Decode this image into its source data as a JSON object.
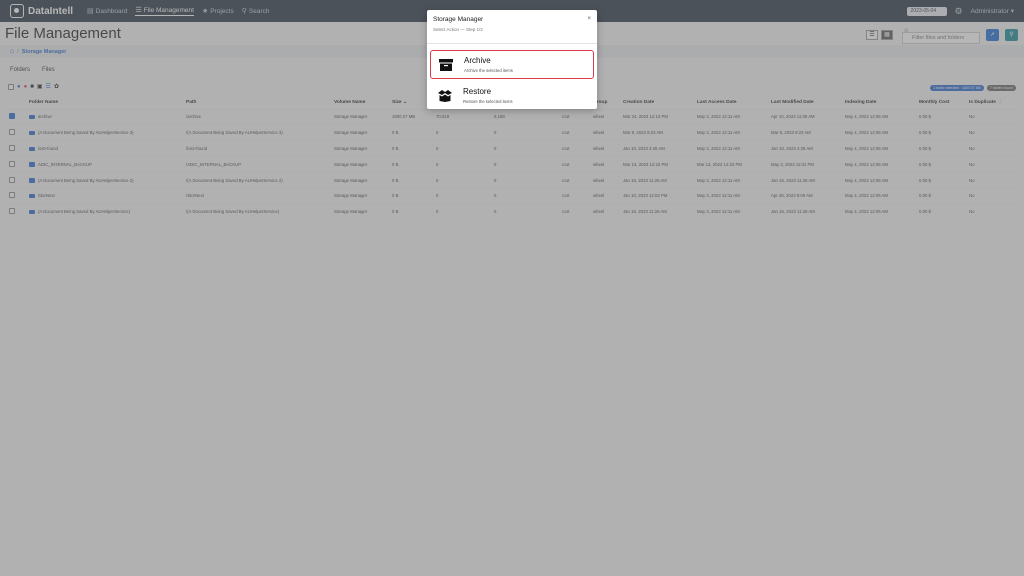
{
  "nav": {
    "brand": "DataIntell",
    "items": [
      {
        "label": "Dashboard",
        "icon": "chart-icon"
      },
      {
        "label": "File Management",
        "icon": "list-icon"
      },
      {
        "label": "Projects",
        "icon": "sitemap-icon"
      },
      {
        "label": "Search",
        "icon": "search-icon"
      }
    ],
    "date": "2023-05-04",
    "user": "Administrator"
  },
  "page": {
    "title": "File Management",
    "filter_placeholder": "Filter files and folders",
    "breadcrumb": "Storage Manager"
  },
  "tabs": [
    "Folders",
    "Files"
  ],
  "summary": {
    "selected": "1 folder selected · 1800.07 MB",
    "found": "7 folders found"
  },
  "table": {
    "columns": [
      "Folder Name",
      "Path",
      "Volume Name",
      "Size",
      "",
      "",
      "",
      "Group",
      "Creation Date",
      "Last Access Date",
      "Last Modified Date",
      "Indexing Date",
      "Monthly Cost",
      "Is Duplicate"
    ],
    "rows": [
      {
        "checked": true,
        "name": "archive",
        "path": "/archive",
        "volume": "Storage Manager",
        "size": "1800.07 MB",
        "c1": "70,519",
        "c2": "9,188",
        "owner": "root",
        "group": "wheel",
        "created": "Mar 24, 2023 12:13 PM",
        "accessed": "May 3, 2023 12:11 AM",
        "modified": "Apr 10, 2023 11:08 AM",
        "indexed": "May 4, 2023 12:06 AM",
        "cost": "0.00 $",
        "dup": "No"
      },
      {
        "checked": false,
        "name": "(A Document Being Saved By AUHelperService 3)",
        "path": "/(A Document Being Saved By AUHelperService 3)",
        "volume": "Storage Manager",
        "size": "0 B",
        "c1": "0",
        "c2": "0",
        "owner": "root",
        "group": "wheel",
        "created": "Mar 8, 2023 8:23 AM",
        "accessed": "May 3, 2023 12:11 AM",
        "modified": "Mar 8, 2023 8:23 AM",
        "indexed": "May 4, 2023 12:06 AM",
        "cost": "0.00 $",
        "dup": "No"
      },
      {
        "checked": false,
        "name": "lost+found",
        "path": "/lost+found",
        "volume": "Storage Manager",
        "size": "0 B",
        "c1": "0",
        "c2": "0",
        "owner": "root",
        "group": "wheel",
        "created": "Jan 10, 2023 4:28 AM",
        "accessed": "May 3, 2023 12:11 AM",
        "modified": "Jan 10, 2023 4:28 AM",
        "indexed": "May 4, 2023 12:06 AM",
        "cost": "0.00 $",
        "dup": "No"
      },
      {
        "checked": false,
        "name": "ADIC_INTERNAL_BACKUP",
        "path": "/ADIC_INTERNAL_BACKUP",
        "volume": "Storage Manager",
        "size": "0 B",
        "c1": "0",
        "c2": "0",
        "owner": "root",
        "group": "wheel",
        "created": "Mar 13, 2023 12:23 PM",
        "accessed": "Mar 13, 2023 12:23 PM",
        "modified": "May 3, 2023 11:01 PM",
        "indexed": "May 4, 2023 12:06 AM",
        "cost": "0.00 $",
        "dup": "No"
      },
      {
        "checked": false,
        "name": "(A Document Being Saved By AUHelperService 2)",
        "path": "/(A Document Being Saved By AUHelperService 2)",
        "volume": "Storage Manager",
        "size": "0 B",
        "c1": "0",
        "c2": "0",
        "owner": "root",
        "group": "wheel",
        "created": "Jan 16, 2023 11:26 AM",
        "accessed": "May 3, 2023 12:11 AM",
        "modified": "Jan 16, 2023 11:26 AM",
        "indexed": "May 4, 2023 12:06 AM",
        "cost": "0.00 $",
        "dup": "No"
      },
      {
        "checked": false,
        "name": "StorNext",
        "path": "/StorNext",
        "volume": "Storage Manager",
        "size": "0 B",
        "c1": "0",
        "c2": "0",
        "owner": "root",
        "group": "wheel",
        "created": "Jan 10, 2023 12:03 PM",
        "accessed": "May 3, 2023 12:11 AM",
        "modified": "Apr 28, 2023 8:09 AM",
        "indexed": "May 4, 2023 12:06 AM",
        "cost": "0.00 $",
        "dup": "No"
      },
      {
        "checked": false,
        "name": "(A Document Being Saved By AUHelperService)",
        "path": "/(A Document Being Saved By AUHelperService)",
        "volume": "Storage Manager",
        "size": "0 B",
        "c1": "0",
        "c2": "0",
        "owner": "root",
        "group": "wheel",
        "created": "Jan 16, 2023 11:26 AM",
        "accessed": "May 3, 2023 12:11 AM",
        "modified": "Jan 16, 2023 11:26 AM",
        "indexed": "May 4, 2023 12:06 AM",
        "cost": "0.00 $",
        "dup": "No"
      }
    ]
  },
  "modal": {
    "title": "Storage Manager",
    "subtitle": "Select Action — Step 1/2",
    "close": "×",
    "options": [
      {
        "label": "Archive",
        "desc": "Archive the selected items",
        "icon": "archive-box-icon"
      },
      {
        "label": "Restore",
        "desc": "Restore the selected items",
        "icon": "open-box-icon"
      }
    ]
  }
}
